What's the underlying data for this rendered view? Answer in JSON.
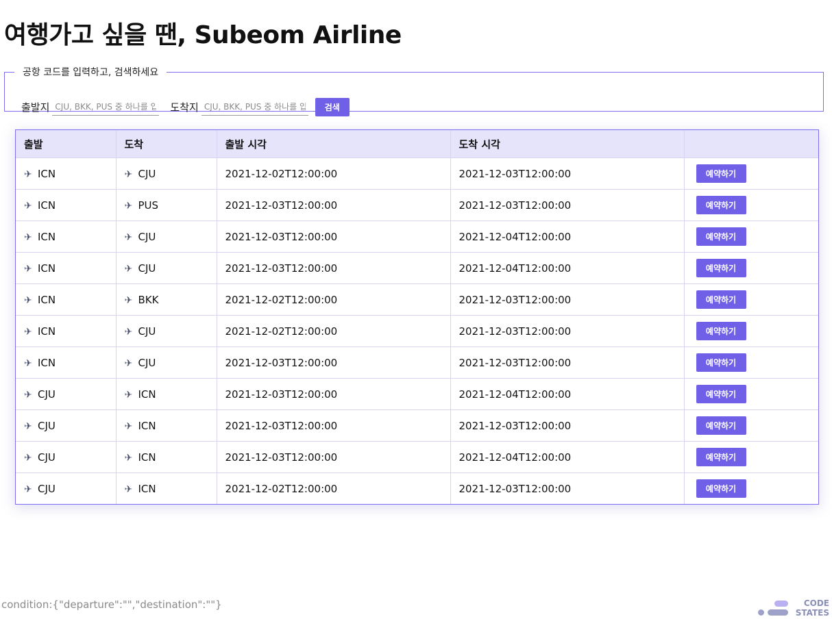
{
  "header": {
    "title": "여행가고 싶을 땐, Subeom Airline"
  },
  "search": {
    "legend": "공항 코드를 입력하고, 검색하세요",
    "departure_label": "출발지",
    "departure_placeholder": "CJU, BKK, PUS 중 하나를 입력하세요",
    "destination_label": "도착지",
    "destination_placeholder": "CJU, BKK, PUS 중 하나를 입력하세요",
    "button_label": "검색"
  },
  "table": {
    "headers": [
      "출발",
      "도착",
      "출발 시각",
      "도착 시각",
      ""
    ],
    "icons": {
      "departure": "airplane-departure-icon",
      "arrival": "airplane-arrival-icon"
    },
    "rows": [
      {
        "departure": "ICN",
        "destination": "CJU",
        "departure_time": "2021-12-02T12:00:00",
        "arrival_time": "2021-12-03T12:00:00",
        "action": "예약하기"
      },
      {
        "departure": "ICN",
        "destination": "PUS",
        "departure_time": "2021-12-03T12:00:00",
        "arrival_time": "2021-12-03T12:00:00",
        "action": "예약하기"
      },
      {
        "departure": "ICN",
        "destination": "CJU",
        "departure_time": "2021-12-03T12:00:00",
        "arrival_time": "2021-12-04T12:00:00",
        "action": "예약하기"
      },
      {
        "departure": "ICN",
        "destination": "CJU",
        "departure_time": "2021-12-03T12:00:00",
        "arrival_time": "2021-12-04T12:00:00",
        "action": "예약하기"
      },
      {
        "departure": "ICN",
        "destination": "BKK",
        "departure_time": "2021-12-02T12:00:00",
        "arrival_time": "2021-12-03T12:00:00",
        "action": "예약하기"
      },
      {
        "departure": "ICN",
        "destination": "CJU",
        "departure_time": "2021-12-02T12:00:00",
        "arrival_time": "2021-12-03T12:00:00",
        "action": "예약하기"
      },
      {
        "departure": "ICN",
        "destination": "CJU",
        "departure_time": "2021-12-03T12:00:00",
        "arrival_time": "2021-12-03T12:00:00",
        "action": "예약하기"
      },
      {
        "departure": "CJU",
        "destination": "ICN",
        "departure_time": "2021-12-03T12:00:00",
        "arrival_time": "2021-12-04T12:00:00",
        "action": "예약하기"
      },
      {
        "departure": "CJU",
        "destination": "ICN",
        "departure_time": "2021-12-03T12:00:00",
        "arrival_time": "2021-12-03T12:00:00",
        "action": "예약하기"
      },
      {
        "departure": "CJU",
        "destination": "ICN",
        "departure_time": "2021-12-03T12:00:00",
        "arrival_time": "2021-12-04T12:00:00",
        "action": "예약하기"
      },
      {
        "departure": "CJU",
        "destination": "ICN",
        "departure_time": "2021-12-02T12:00:00",
        "arrival_time": "2021-12-03T12:00:00",
        "action": "예약하기"
      }
    ]
  },
  "footer": {
    "condition": "condition:{\"departure\":\"\",\"destination\":\"\"}",
    "logo_line1": "CODE",
    "logo_line2": "STATES"
  },
  "colors": {
    "accent": "#7060e8",
    "border": "#7b6cf0",
    "header_bg": "#e6e4fb"
  }
}
